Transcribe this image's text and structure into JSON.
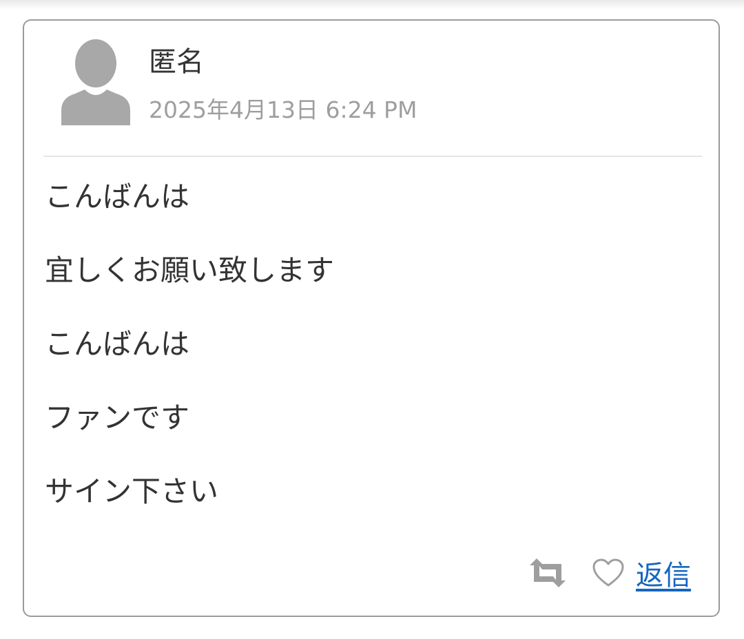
{
  "comment": {
    "author": "匿名",
    "timestamp": "2025年4月13日 6:24 PM",
    "lines": [
      "こんばんは",
      "宜しくお願い致します",
      "こんばんは",
      "ファンです",
      "サイン下さい"
    ],
    "actions": {
      "retweet_icon": "retweet-icon",
      "like_icon": "heart-outline-icon",
      "reply_label": "返信"
    }
  },
  "colors": {
    "text": "#333333",
    "muted": "#9e9e9e",
    "icon": "#9e9e9e",
    "link": "#1565c0",
    "border": "#9a9a9a"
  }
}
